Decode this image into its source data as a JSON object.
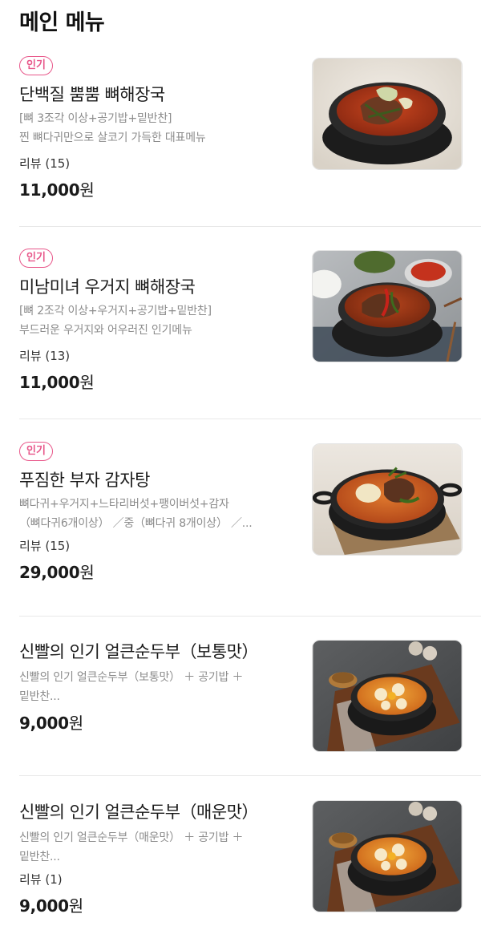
{
  "section": {
    "title": "메인 메뉴"
  },
  "menu": [
    {
      "badge": "인기",
      "name": "단백질 뿜뿜 뼈해장국",
      "desc_lines": [
        "[뼈 3조각 이상+공기밥+밑반찬]",
        "찐 뼈다귀만으로 살코기 가득한 대표메뉴"
      ],
      "review": "리뷰 (15)",
      "price": "11,000",
      "currency": "원",
      "image": "haejangguk-bowl-image"
    },
    {
      "badge": "인기",
      "name": "미남미녀 우거지 뼈해장국",
      "desc_lines": [
        "[뼈 2조각 이상+우거지+공기밥+밑반찬]",
        "부드러운 우거지와 어우러진 인기메뉴"
      ],
      "review": "리뷰 (13)",
      "price": "11,000",
      "currency": "원",
      "image": "ugeoji-haejangguk-image"
    },
    {
      "badge": "인기",
      "name": "푸짐한 부자 감자탕",
      "desc_lines": [
        "뼈다귀+우거지+느타리버섯+팽이버섯+감자",
        "（뼈다귀6개이상） ／중（뼈다귀 8개이상） ／..."
      ],
      "review": "리뷰 (15)",
      "price": "29,000",
      "currency": "원",
      "image": "gamjatang-pot-image"
    },
    {
      "badge": "",
      "name": "신빨의 인기 얼큰순두부（보통맛）",
      "desc_lines": [
        "신빨의 인기 얼큰순두부（보통맛） ＋ 공기밥 ＋",
        "밑반찬..."
      ],
      "review": "",
      "price": "9,000",
      "currency": "원",
      "image": "sundubu-mild-image"
    },
    {
      "badge": "",
      "name": "신빨의 인기 얼큰순두부（매운맛）",
      "desc_lines": [
        "신빨의 인기 얼큰순두부（매운맛） ＋ 공기밥 ＋",
        "밑반찬..."
      ],
      "review": "리뷰 (1)",
      "price": "9,000",
      "currency": "원",
      "image": "sundubu-spicy-image"
    }
  ],
  "colors": {
    "badge": "#e8578a",
    "divider": "#e8e8e8",
    "desc": "#8c8c8c"
  }
}
